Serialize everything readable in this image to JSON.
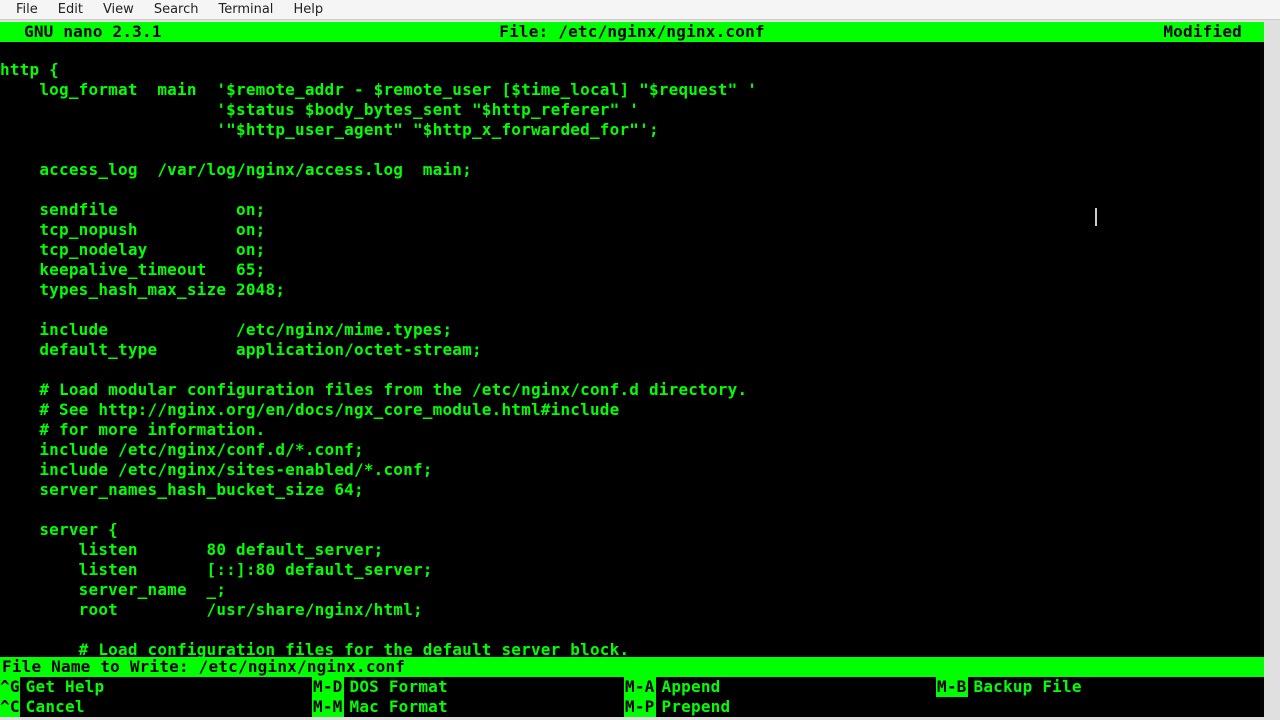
{
  "menubar": {
    "items": [
      "File",
      "Edit",
      "View",
      "Search",
      "Terminal",
      "Help"
    ]
  },
  "nano": {
    "title_left": "GNU nano 2.3.1",
    "title_center": "File: /etc/nginx/nginx.conf",
    "title_right": "Modified"
  },
  "editor_lines": [
    "http {",
    "    log_format  main  '$remote_addr - $remote_user [$time_local] \"$request\" '",
    "                      '$status $body_bytes_sent \"$http_referer\" '",
    "                      '\"$http_user_agent\" \"$http_x_forwarded_for\"';",
    "",
    "    access_log  /var/log/nginx/access.log  main;",
    "",
    "    sendfile            on;",
    "    tcp_nopush          on;",
    "    tcp_nodelay         on;",
    "    keepalive_timeout   65;",
    "    types_hash_max_size 2048;",
    "",
    "    include             /etc/nginx/mime.types;",
    "    default_type        application/octet-stream;",
    "",
    "    # Load modular configuration files from the /etc/nginx/conf.d directory.",
    "    # See http://nginx.org/en/docs/ngx_core_module.html#include",
    "    # for more information.",
    "    include /etc/nginx/conf.d/*.conf;",
    "    include /etc/nginx/sites-enabled/*.conf;",
    "    server_names_hash_bucket_size 64;",
    "",
    "    server {",
    "        listen       80 default_server;",
    "        listen       [::]:80 default_server;",
    "        server_name  _;",
    "        root         /usr/share/nginx/html;",
    "",
    "        # Load configuration files for the default server block."
  ],
  "prompt": "File Name to Write: /etc/nginx/nginx.conf",
  "shortcuts": {
    "row1": [
      {
        "key": "^G",
        "label": "Get Help"
      },
      {
        "key": "M-D",
        "label": "DOS Format"
      },
      {
        "key": "M-A",
        "label": "Append"
      },
      {
        "key": "M-B",
        "label": "Backup File"
      }
    ],
    "row2": [
      {
        "key": "^C",
        "label": "Cancel"
      },
      {
        "key": "M-M",
        "label": "Mac Format"
      },
      {
        "key": "M-P",
        "label": "Prepend"
      },
      {
        "key": "",
        "label": ""
      }
    ]
  }
}
